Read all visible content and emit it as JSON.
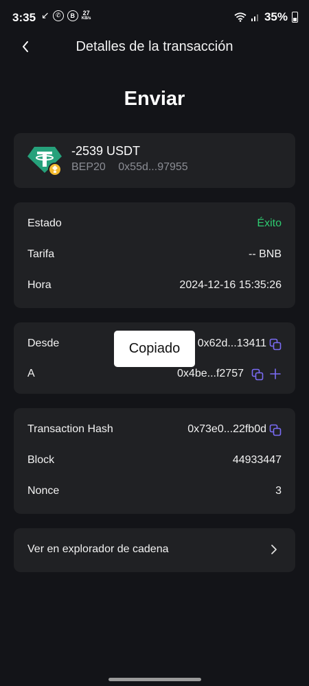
{
  "status_bar": {
    "time": "3:35",
    "speed_value": "27",
    "speed_unit": "KB/s",
    "battery": "35%",
    "icons": [
      "missed-call-icon",
      "whatsapp-icon",
      "b-icon",
      "wifi-icon",
      "signal-icon",
      "battery-icon"
    ]
  },
  "header": {
    "title": "Detalles de la transacción"
  },
  "page_title": "Enviar",
  "token": {
    "amount": "-2539 USDT",
    "network": "BEP20",
    "address": "0x55d...97955",
    "icon": "tether-icon",
    "badge_icon": "bnb-icon"
  },
  "details": {
    "status_label": "Estado",
    "status_value": "Éxito",
    "fee_label": "Tarifa",
    "fee_value": "-- BNB",
    "time_label": "Hora",
    "time_value": "2024-12-16 15:35:26"
  },
  "addresses": {
    "from_label": "Desde",
    "from_value": "0x62d...13411",
    "to_label": "A",
    "to_value": "0x4be...f2757"
  },
  "chain": {
    "hash_label": "Transaction Hash",
    "hash_value": "0x73e0...22fb0d",
    "block_label": "Block",
    "block_value": "44933447",
    "nonce_label": "Nonce",
    "nonce_value": "3"
  },
  "explorer": {
    "label": "Ver en explorador de cadena"
  },
  "toast": {
    "text": "Copiado"
  },
  "colors": {
    "background": "#131418",
    "card": "#202124",
    "success": "#2ecc71",
    "accent_icon": "#7b6cf6",
    "tether": "#26a17b",
    "bnb": "#f3ba2f"
  }
}
